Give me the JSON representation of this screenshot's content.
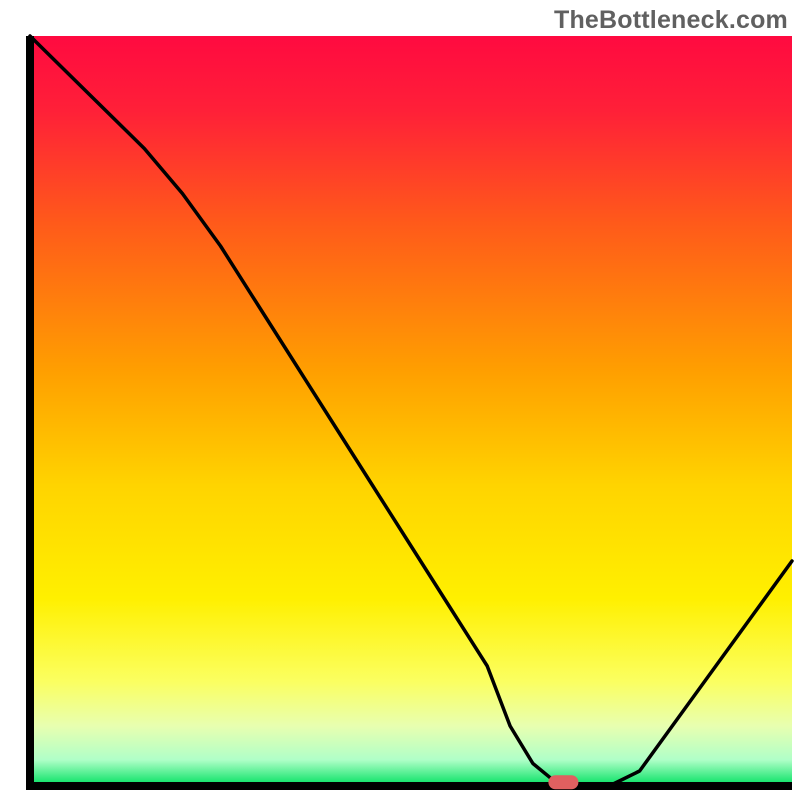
{
  "watermark": "TheBottleneck.com",
  "chart_data": {
    "type": "line",
    "title": "",
    "xlabel": "",
    "ylabel": "",
    "xlim": [
      0,
      100
    ],
    "ylim": [
      0,
      100
    ],
    "x": [
      0,
      5,
      10,
      15,
      20,
      25,
      30,
      35,
      40,
      45,
      50,
      55,
      60,
      63,
      66,
      69,
      72,
      76,
      80,
      85,
      90,
      95,
      100
    ],
    "values": [
      100,
      95,
      90,
      85,
      79,
      72,
      64,
      56,
      48,
      40,
      32,
      24,
      16,
      8,
      3,
      0.5,
      0,
      0,
      2,
      9,
      16,
      23,
      30
    ],
    "marker": {
      "x": 70,
      "y": 0.5
    },
    "gradient_stops": [
      {
        "offset": 0.0,
        "color": "#ff0a40"
      },
      {
        "offset": 0.1,
        "color": "#ff2038"
      },
      {
        "offset": 0.25,
        "color": "#ff5a1a"
      },
      {
        "offset": 0.45,
        "color": "#ffa000"
      },
      {
        "offset": 0.6,
        "color": "#ffd400"
      },
      {
        "offset": 0.75,
        "color": "#fff000"
      },
      {
        "offset": 0.86,
        "color": "#fbff60"
      },
      {
        "offset": 0.92,
        "color": "#e8ffb0"
      },
      {
        "offset": 0.965,
        "color": "#b0ffc8"
      },
      {
        "offset": 1.0,
        "color": "#00e060"
      }
    ],
    "axis_color": "#000000",
    "line_color": "#000000",
    "marker_color": "#e06060"
  }
}
